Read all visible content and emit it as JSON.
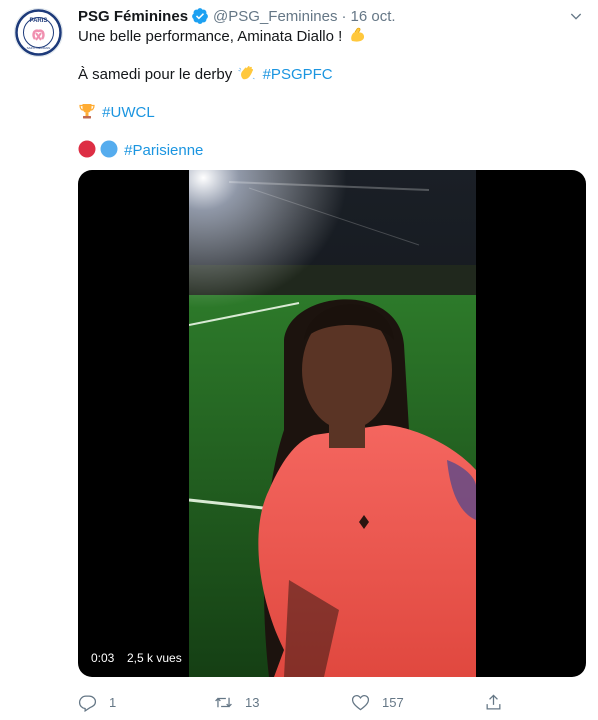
{
  "account": {
    "name": "PSG Féminines",
    "handle": "@PSG_Feminines",
    "separator": "·",
    "date": "16 oct.",
    "avatar_text": "PARIS",
    "avatar_subtext": "SAINT-GERMAIN"
  },
  "tweet": {
    "line1": "Une belle performance, Aminata Diallo !",
    "line2_prefix": "À samedi pour le derby",
    "line2_hashtag": "#PSGPFC",
    "line3_hashtag": "#UWCL",
    "line4_hashtag": "#Parisienne"
  },
  "icons": {
    "line1_emoji": "flexed-biceps-icon",
    "line2_emoji": "waving-hand-icon",
    "line3_emoji": "trophy-icon",
    "line4_emoji_1": "red-circle-icon",
    "line4_emoji_2": "blue-circle-icon"
  },
  "media": {
    "time": "0:03",
    "views": "2,5 k vues"
  },
  "actions": {
    "replies": "1",
    "retweets": "13",
    "likes": "157"
  },
  "colors": {
    "link": "#1b95e0",
    "muted": "#657786",
    "verified": "#1da1f2",
    "jersey": "#f0595a"
  }
}
